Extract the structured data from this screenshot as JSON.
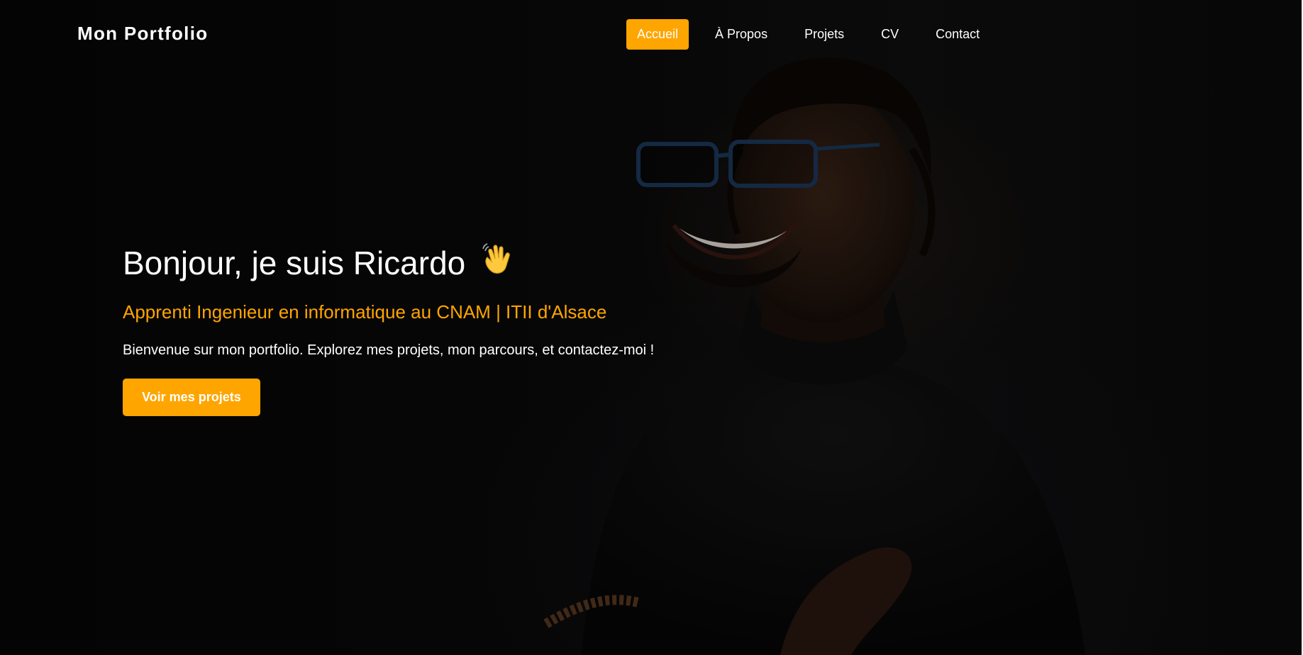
{
  "header": {
    "brand": "Mon Portfolio",
    "nav": [
      {
        "label": "Accueil",
        "active": true
      },
      {
        "label": "À Propos",
        "active": false
      },
      {
        "label": "Projets",
        "active": false
      },
      {
        "label": "CV",
        "active": false
      },
      {
        "label": "Contact",
        "active": false
      }
    ]
  },
  "hero": {
    "title": "Bonjour, je suis Ricardo",
    "title_emoji": "waving-hand",
    "subtitle": "Apprenti Ingenieur en informatique au CNAM | ITII d'Alsace",
    "intro": "Bienvenue sur mon portfolio. Explorez mes projets, mon parcours, et contactez-moi !",
    "cta_label": "Voir mes projets"
  },
  "colors": {
    "accent": "#ffa500",
    "background": "#080808",
    "text": "#ffffff"
  }
}
